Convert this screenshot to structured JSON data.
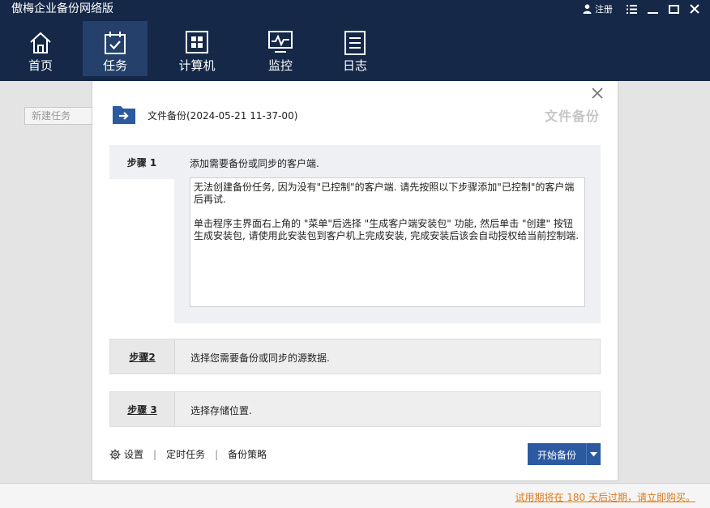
{
  "app": {
    "title": "傲梅企业备份网络版"
  },
  "window_controls": {
    "register_label": "注册"
  },
  "nav": {
    "tabs": [
      {
        "label": "首页",
        "icon": "home-icon"
      },
      {
        "label": "任务",
        "icon": "task-icon",
        "active": true
      },
      {
        "label": "计算机",
        "icon": "computer-icon"
      },
      {
        "label": "监控",
        "icon": "monitor-icon"
      },
      {
        "label": "日志",
        "icon": "log-icon"
      }
    ]
  },
  "left": {
    "new_task_label": "新建任务"
  },
  "dialog": {
    "title": "文件备份(2024-05-21 11-37-00)",
    "watermark": "文件备份",
    "steps": [
      {
        "label": "步骤 1",
        "description": "添加需要备份或同步的客户端.",
        "message_p1": "无法创建备份任务, 因为没有\"已控制\"的客户端. 请先按照以下步骤添加\"已控制\"的客户端后再试.",
        "message_p2": "单击程序主界面右上角的 \"菜单\"后选择 \"生成客户端安装包\" 功能, 然后单击 \"创建\" 按钮生成安装包, 请使用此安装包到客户机上完成安装, 完成安装后该会自动授权给当前控制端."
      },
      {
        "label": "步骤2",
        "description": "选择您需要备份或同步的源数据."
      },
      {
        "label": "步骤 3",
        "description": "选择存储位置."
      }
    ],
    "footer": {
      "settings_label": "设置",
      "schedule_label": "定时任务",
      "strategy_label": "备份策略",
      "start_button_label": "开始备份"
    }
  },
  "status": {
    "trial_text": "试用期将在 180 天后过期，请立即购买。"
  },
  "colors": {
    "header_bg": "#152848",
    "active_tab": "#25406a",
    "accent_button": "#2c5aa0",
    "trial_link": "#e07a1a"
  }
}
